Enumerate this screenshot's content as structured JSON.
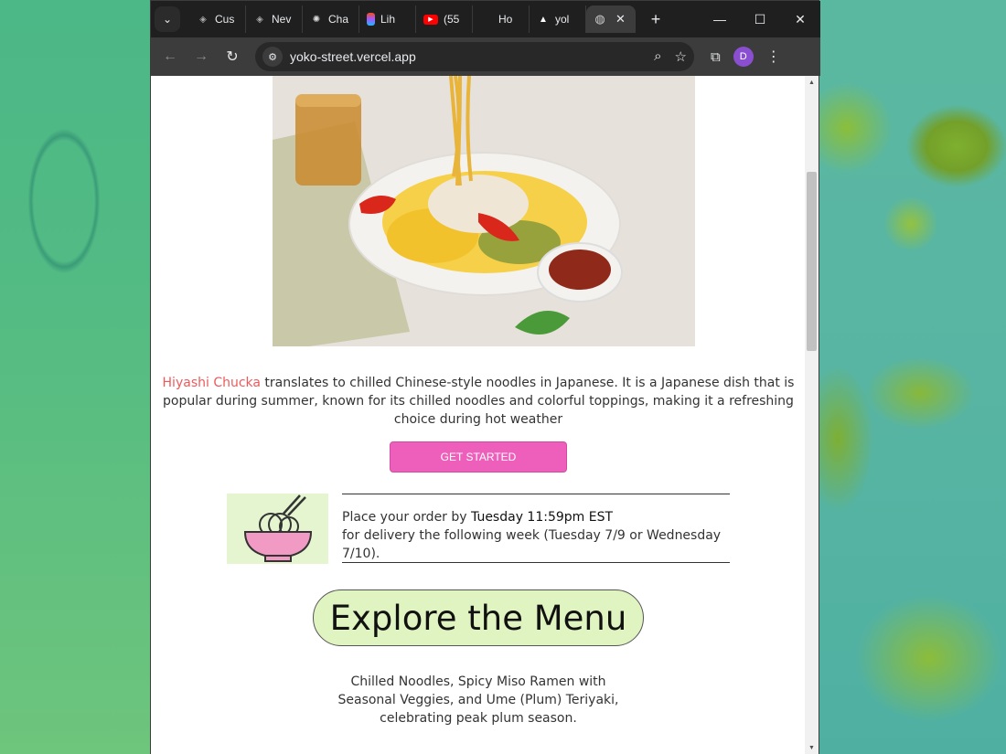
{
  "browser": {
    "tabs": [
      {
        "label": "Cus",
        "icon": "cube-icon"
      },
      {
        "label": "Nev",
        "icon": "cube-icon"
      },
      {
        "label": "Cha",
        "icon": "openai-icon"
      },
      {
        "label": "Lih",
        "icon": "figma-icon"
      },
      {
        "label": "(55",
        "icon": "youtube-icon"
      },
      {
        "label": "Ho",
        "icon": "blank-icon"
      },
      {
        "label": "yol",
        "icon": "triangle-icon"
      }
    ],
    "url": "yoko-street.vercel.app",
    "profile_initial": "D"
  },
  "page": {
    "intro_highlight": "Hiyashi Chucka",
    "intro_rest": " translates to chilled Chinese-style noodles in Japanese. It is a Japanese dish that is popular during summer, known for its chilled noodles and colorful toppings, making it a refreshing choice during hot weather",
    "cta_label": "GET STARTED",
    "order_prefix": "Place your order by ",
    "order_deadline": "Tuesday 11:59pm EST",
    "order_suffix": "for delivery the following week (Tuesday 7/9 or Wednesday 7/10).",
    "explore_label": "Explore the Menu",
    "menu_description": "Chilled Noodles, Spicy Miso Ramen with Seasonal Veggies, and Ume (Plum) Teriyaki, celebrating peak plum season."
  },
  "colors": {
    "accent_pink": "#ee5fbb",
    "highlight_red": "#ee5a5a",
    "explore_bg": "#dff4c0"
  }
}
